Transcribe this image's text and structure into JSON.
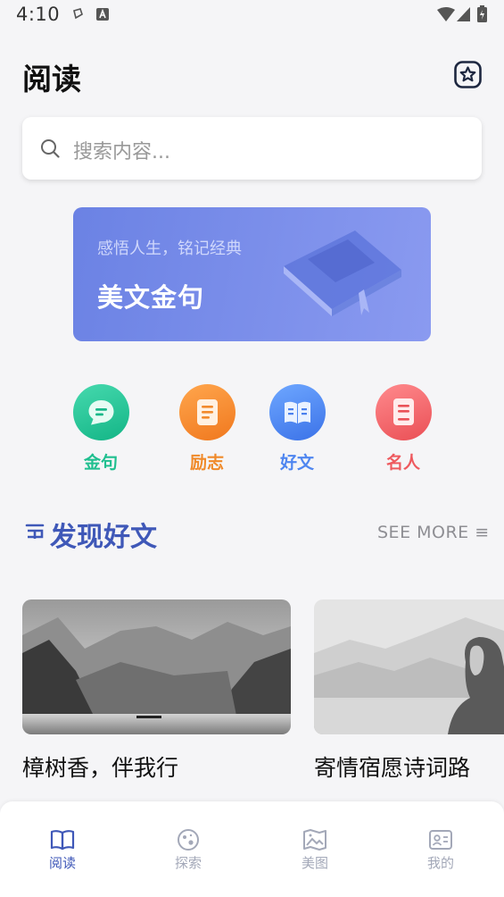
{
  "status_bar": {
    "time": "4:10"
  },
  "header": {
    "title": "阅读",
    "favorites_icon": "star-badge-icon"
  },
  "search": {
    "placeholder": "搜索内容..."
  },
  "banner": {
    "subtitle": "感悟人生，铭记经典",
    "title": "美文金句"
  },
  "categories": [
    {
      "label": "金句",
      "icon": "chat-bubble-icon",
      "color": "#1fbf8f"
    },
    {
      "label": "励志",
      "icon": "notebook-icon",
      "color": "#f08a2a"
    },
    {
      "label": "好文",
      "icon": "open-book-icon",
      "color": "#4f86f0"
    },
    {
      "label": "名人",
      "icon": "document-icon",
      "color": "#ee5a5f"
    }
  ],
  "section": {
    "title": "发现好文",
    "see_more": "SEE MORE ≡"
  },
  "articles": [
    {
      "title": "樟树香，伴我行"
    },
    {
      "title": "寄情宿愿诗词路"
    }
  ],
  "bottom_nav": [
    {
      "label": "阅读",
      "icon": "book-icon",
      "active": true
    },
    {
      "label": "探索",
      "icon": "planet-icon",
      "active": false
    },
    {
      "label": "美图",
      "icon": "picture-icon",
      "active": false
    },
    {
      "label": "我的",
      "icon": "profile-card-icon",
      "active": false
    }
  ],
  "colors": {
    "accent": "#3f58b8",
    "banner": "#7b8ee9",
    "inactive_nav": "#a3a8b8"
  }
}
